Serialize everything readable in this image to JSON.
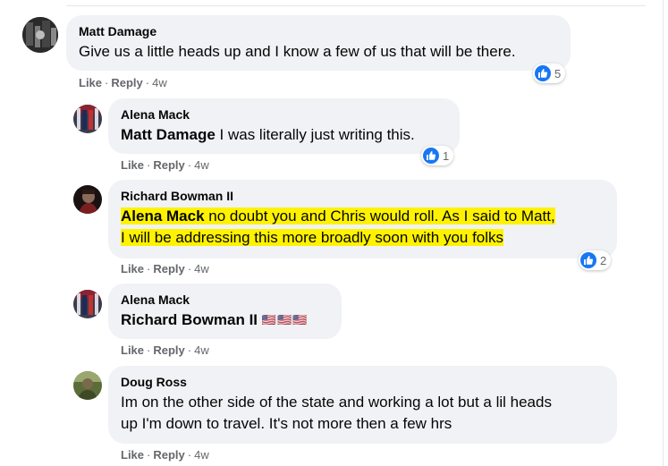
{
  "common": {
    "like_label": "Like",
    "reply_label": "Reply",
    "separator": "·"
  },
  "comments": [
    {
      "author": "Matt Damage",
      "text": "Give us a little heads up and I know a few of us that will be there.",
      "time": "4w",
      "reactions": {
        "type": "like",
        "count": "5"
      }
    },
    {
      "author": "Alena Mack",
      "mention": "Matt Damage",
      "text": " I was literally just writing this.",
      "time": "4w",
      "reactions": {
        "type": "like",
        "count": "1"
      }
    },
    {
      "author": "Richard Bowman II",
      "mention": "Alena Mack",
      "text_line1": " no doubt you and Chris would roll. As I said to Matt,",
      "text_line2": "I will be addressing this more broadly soon with you folks",
      "time": "4w",
      "reactions": {
        "type": "like",
        "count": "2"
      }
    },
    {
      "author": "Alena Mack",
      "mention": "Richard Bowman II",
      "flags": "🇺🇸🇺🇸🇺🇸",
      "time": "4w"
    },
    {
      "author": "Doug Ross",
      "text_line1": "Im on the other side of the state and working a lot but a lil heads",
      "text_line2": "up I'm down to travel. It's not more then a few hrs",
      "time": "4w"
    }
  ],
  "colors": {
    "bubble": "#f0f2f5",
    "like_blue": "#1877f2",
    "highlight": "#fff200",
    "meta": "#65676b"
  }
}
